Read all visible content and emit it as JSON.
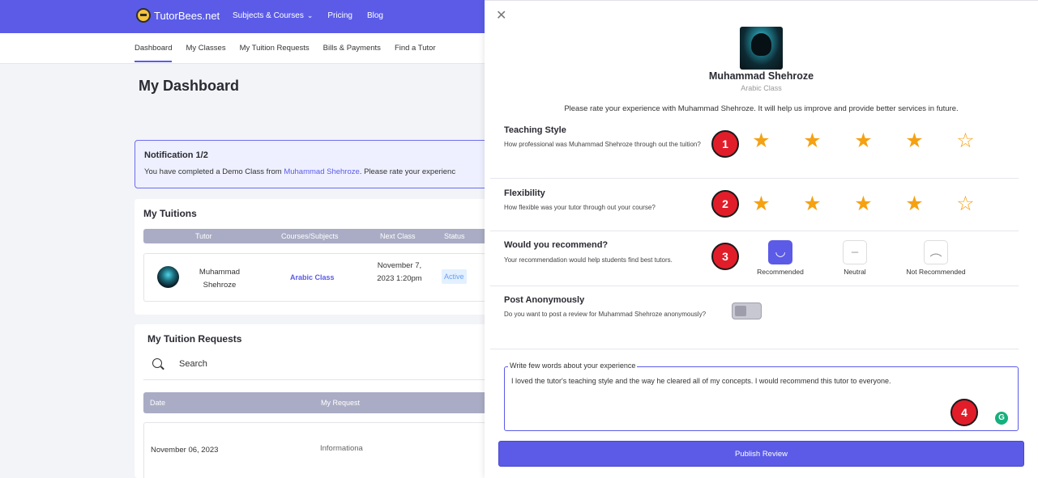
{
  "brand": {
    "logo_text": "TutorBees.net"
  },
  "topnav": {
    "subjects": "Subjects & Courses",
    "pricing": "Pricing",
    "blog": "Blog"
  },
  "subnav": [
    "Dashboard",
    "My Classes",
    "My Tuition Requests",
    "Bills & Payments",
    "Find a Tutor"
  ],
  "dashboard": {
    "title": "My Dashboard"
  },
  "notification": {
    "heading": "Notification 1/2",
    "text_prefix": "You have completed a Demo Class from ",
    "tutor_link": "Muhammad Shehroze",
    "text_suffix": ". Please rate your experienc"
  },
  "tuitions": {
    "title": "My Tuitions",
    "columns": [
      "Tutor",
      "Courses/Subjects",
      "Next Class",
      "Status"
    ],
    "row": {
      "tutor": "Muhammad Shehroze",
      "subject": "Arabic Class",
      "next_class": "November 7, 2023 1:20pm",
      "status": "Active"
    }
  },
  "requests": {
    "title": "My Tuition Requests",
    "search_label": "Search",
    "columns": [
      "Date",
      "My Request"
    ],
    "row": {
      "date": "November 06, 2023",
      "request": "Informationa"
    }
  },
  "review_panel": {
    "tutor_name": "Muhammad Shehroze",
    "tutor_subject": "Arabic Class",
    "prompt": "Please rate your experience with Muhammad Shehroze. It will help us improve and provide better services in future.",
    "teaching": {
      "title": "Teaching Style",
      "desc": "How professional was Muhammad Shehroze through out the tuition?",
      "badge": "1",
      "rating": 4,
      "max": 5
    },
    "flexibility": {
      "title": "Flexibility",
      "desc": "How flexible was your tutor through out your course?",
      "badge": "2",
      "rating": 4,
      "max": 5
    },
    "recommend": {
      "title": "Would you recommend?",
      "desc": "Your recommendation would help students find best tutors.",
      "badge": "3",
      "options": [
        "Recommended",
        "Neutral",
        "Not Recommended"
      ],
      "selected": "Recommended"
    },
    "anonymous": {
      "title": "Post Anonymously",
      "desc": "Do you want to post a review for Muhammad Shehroze anonymously?",
      "enabled": false
    },
    "comment": {
      "label": "Write few words about your experience",
      "value": "I loved the tutor's teaching style and the way he cleared all of my concepts. I would recommend this tutor to everyone.",
      "badge": "4"
    },
    "publish_label": "Publish Review"
  },
  "colors": {
    "accent": "#5b5be8",
    "star": "#f5a112",
    "badge": "#e21d2a",
    "status_bg": "#e3f0ff"
  }
}
